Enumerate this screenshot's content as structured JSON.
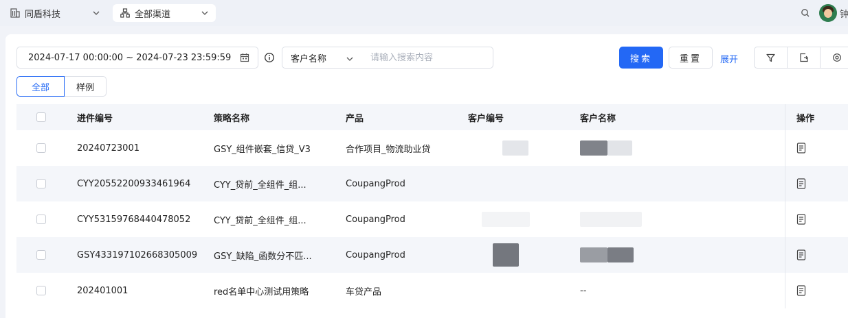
{
  "topbar": {
    "company": "同盾科技",
    "channel": "全部渠道",
    "user_initial": "钟"
  },
  "filters": {
    "date_range": "2024-07-17 00:00:00 ~ 2024-07-23 23:59:59",
    "field_select": "客户名称",
    "search_placeholder": "请输入搜索内容",
    "search_button": "搜索",
    "reset_button": "重置",
    "expand_link": "展开"
  },
  "tabs": [
    {
      "label": "全部",
      "active": true
    },
    {
      "label": "样例",
      "active": false
    }
  ],
  "table": {
    "columns": [
      "进件编号",
      "策略名称",
      "产品",
      "客户编号",
      "客户名称",
      "操作"
    ],
    "rows": [
      {
        "id": "20240723001",
        "strategy": "GSY_组件嵌套_信贷_V3",
        "product": "合作项目_物流助业贷",
        "customer_no": "",
        "customer_name": ""
      },
      {
        "id": "CYY20552200933461964",
        "strategy": "CYY_贷前_全组件_组...",
        "product": "CoupangProd",
        "customer_no": "",
        "customer_name": ""
      },
      {
        "id": "CYY53159768440478052",
        "strategy": "CYY_贷前_全组件_组...",
        "product": "CoupangProd",
        "customer_no": "",
        "customer_name": ""
      },
      {
        "id": "GSY433197102668305009",
        "strategy": "GSY_缺陷_函数分不匹...",
        "product": "CoupangProd",
        "customer_no": "",
        "customer_name": ""
      },
      {
        "id": "202401001",
        "strategy": "red名单中心测试用策略",
        "product": "车贷产品",
        "customer_no": "",
        "customer_name": "--"
      }
    ]
  },
  "colors": {
    "primary": "#2368f5",
    "row_stripe": "#f4f6fa",
    "border": "#dcdfe6"
  }
}
